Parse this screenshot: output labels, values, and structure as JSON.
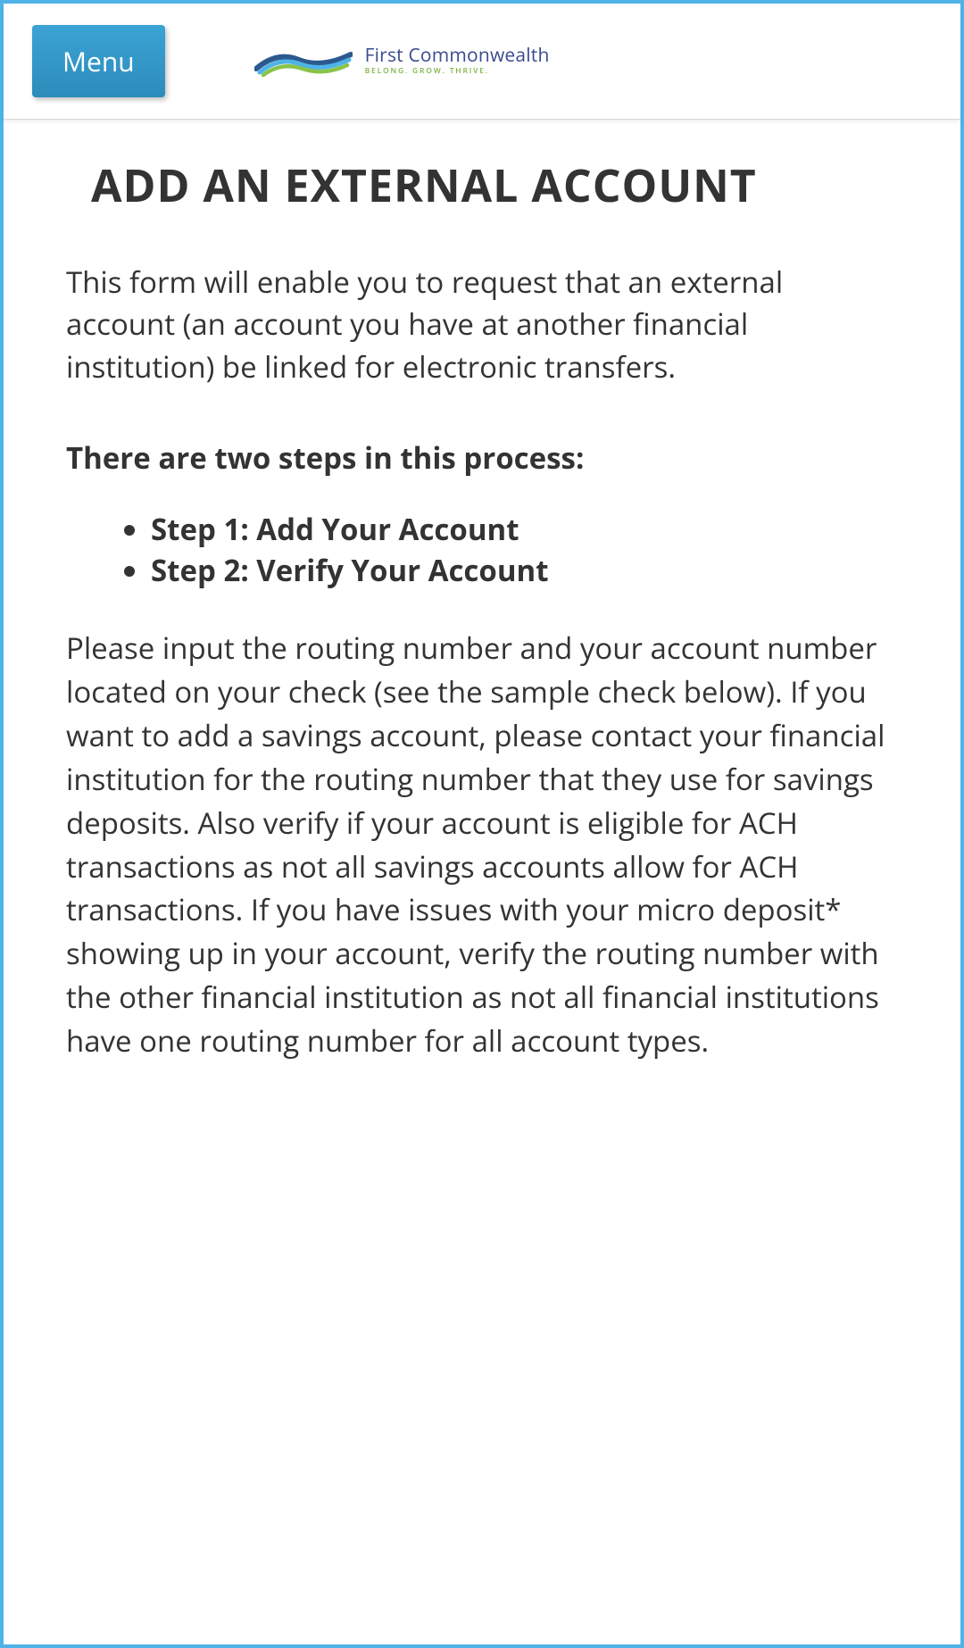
{
  "header": {
    "menu_label": "Menu",
    "logo": {
      "name": "First Commonwealth",
      "tagline": "BELONG. GROW. THRIVE."
    }
  },
  "main": {
    "title": "ADD AN EXTERNAL ACCOUNT",
    "intro": "This form will enable you to request that an external account (an account you have at another financial institution) be linked for electronic transfers.",
    "steps_heading": "There are two steps in this process:",
    "steps": [
      "Step 1: Add Your Account",
      "Step 2: Verify Your Account"
    ],
    "body": "Please input the routing number and your account number located on your check (see the sample check below). If you want to add a savings account, please contact your financial institution for the routing number that they use for savings deposits. Also verify if your account is eligible for ACH transactions as not all savings accounts allow for ACH transactions. If you have issues with your micro deposit* showing up in your account, verify the routing number with the other financial institution as not all financial institutions have one routing number for all account types."
  }
}
